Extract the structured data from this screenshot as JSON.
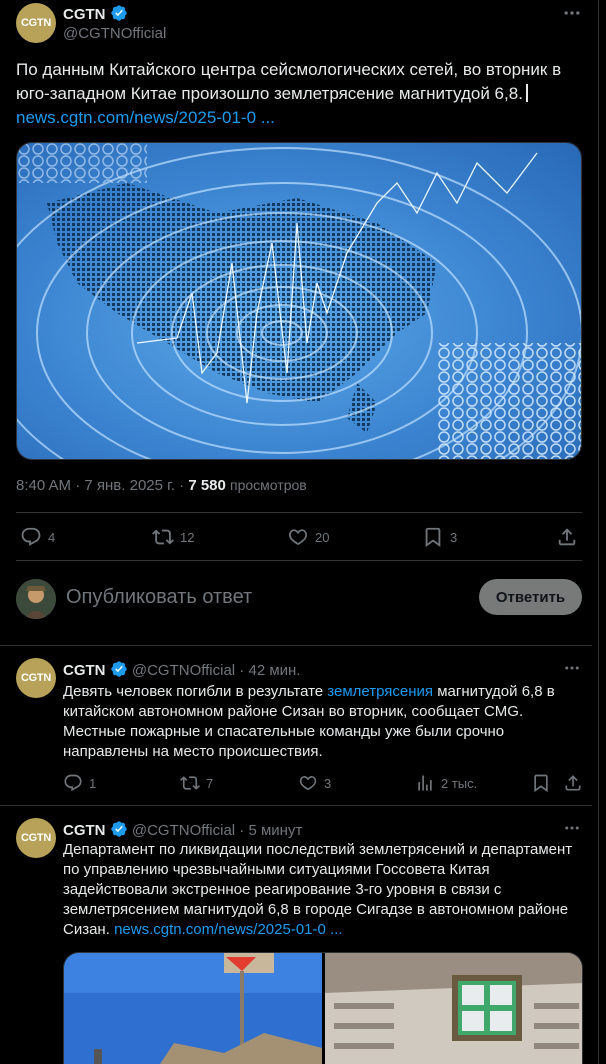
{
  "main_tweet": {
    "author_name": "CGTN",
    "author_handle": "@CGTNOfficial",
    "avatar_text": "CGTN",
    "text": "По данным Китайского центра сейсмологических сетей, во вторник в юго-западном Китае произошло землетрясение магнитудой 6,8.",
    "link": "news.cgtn.com/news/2025-01-0 ...",
    "image_alt": "earthquake-seismic-map",
    "time": "8:40 AM",
    "date": "7 янв. 2025 г.",
    "views_count": "7 580",
    "views_label": "просмотров",
    "replies": "4",
    "retweets": "12",
    "likes": "20",
    "bookmarks": "3"
  },
  "reply_box": {
    "placeholder": "Опубликовать ответ",
    "button_label": "Ответить"
  },
  "replies": [
    {
      "author_name": "CGTN",
      "author_handle": "@CGTNOfficial",
      "time": "42 мин.",
      "avatar_text": "CGTN",
      "text_before": "Девять человек погибли в результате ",
      "text_link": "землетрясения",
      "text_after": " магнитудой 6,8 в китайском автономном районе Сизан во вторник, сообщает CMG. Местные пожарные и спасательные команды уже были срочно направлены на место происшествия.",
      "replies": "1",
      "retweets": "7",
      "likes": "3",
      "views": "2 тыс."
    },
    {
      "author_name": "CGTN",
      "author_handle": "@CGTNOfficial",
      "time": "5 минут",
      "avatar_text": "CGTN",
      "text": "Департамент по ликвидации последствий землетрясений и департамент по управлению чрезвычайными ситуациями Госсовета Китая задействовали экстренное реагирование 3-го уровня в связи с землетрясением магнитудой 6,8 в городе Сигадзе в автономном районе Сизан. ",
      "link": "news.cgtn.com/news/2025-01-0 ..."
    }
  ],
  "colors": {
    "accent": "#1d9bf0",
    "muted": "#71767b",
    "text": "#e7e9ea",
    "border": "#2f3336",
    "background": "#000000"
  }
}
